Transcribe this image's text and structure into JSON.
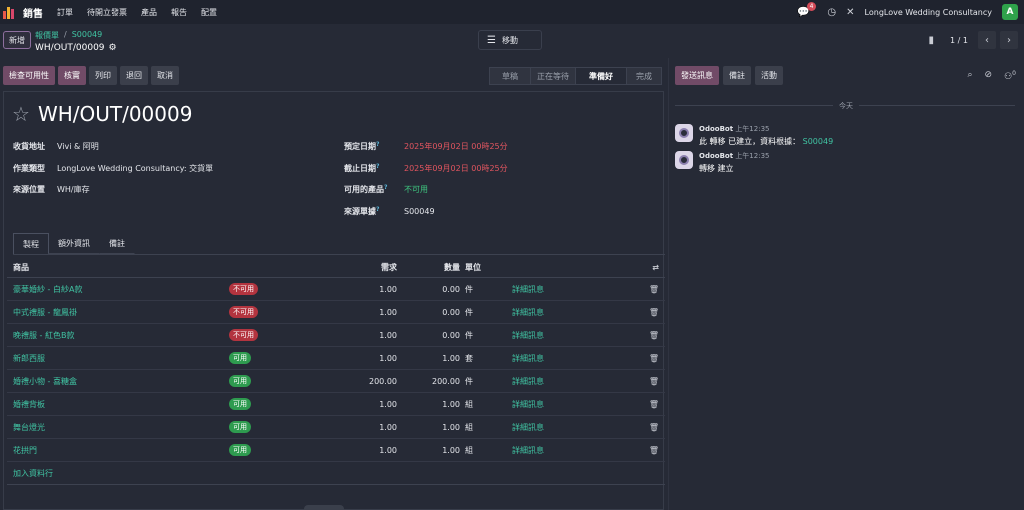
{
  "navbar": {
    "app_name": "銷售",
    "menu": [
      "訂單",
      "待開立發票",
      "產品",
      "報告",
      "配置"
    ],
    "notification_count": "4",
    "company": "LongLove Wedding Consultancy",
    "user_initial": "A"
  },
  "control": {
    "new_label": "新增",
    "breadcrumb": [
      "報價單",
      "S00049"
    ],
    "record_name": "WH/OUT/00009",
    "move_label": "移動",
    "pager": "1 / 1"
  },
  "actions": {
    "check_availability": "檢查可用性",
    "validate": "核實",
    "print": "列印",
    "return": "退回",
    "cancel": "取消"
  },
  "statusbar": {
    "stages": [
      "草稿",
      "正在等待",
      "準備好",
      "完成"
    ],
    "active": "準備好"
  },
  "form": {
    "title": "WH/OUT/00009",
    "left": [
      {
        "label": "收貨地址",
        "value": "Vivi & 阿明"
      },
      {
        "label": "作業類型",
        "value": "LongLove Wedding Consultancy: 交貨單"
      },
      {
        "label": "來源位置",
        "value": "WH/庫存"
      }
    ],
    "right": [
      {
        "label": "預定日期",
        "value": "2025年09月02日 00時25分"
      },
      {
        "label": "截止日期",
        "value": "2025年09月02日 00時25分"
      },
      {
        "label": "可用的產品",
        "value": "不可用"
      },
      {
        "label": "來源單據",
        "value": "S00049"
      }
    ]
  },
  "tabs": [
    "製程",
    "額外資訊",
    "備註"
  ],
  "table": {
    "headers": {
      "product": "商品",
      "demand": "需求",
      "quantity": "數量",
      "unit": "單位"
    },
    "rows": [
      {
        "product": "豪華婚紗 - 白紗A款",
        "status": "不可用",
        "demand": "1.00",
        "quantity": "0.00",
        "unit": "件",
        "detail": "詳細訊息"
      },
      {
        "product": "中式禮服 - 龍鳳褂",
        "status": "不可用",
        "demand": "1.00",
        "quantity": "0.00",
        "unit": "件",
        "detail": "詳細訊息"
      },
      {
        "product": "晚禮服 - 紅色B款",
        "status": "不可用",
        "demand": "1.00",
        "quantity": "0.00",
        "unit": "件",
        "detail": "詳細訊息"
      },
      {
        "product": "新郎西服",
        "status": "可用",
        "demand": "1.00",
        "quantity": "1.00",
        "unit": "套",
        "detail": "詳細訊息"
      },
      {
        "product": "婚禮小物 - 喜糖盒",
        "status": "可用",
        "demand": "200.00",
        "quantity": "200.00",
        "unit": "件",
        "detail": "詳細訊息"
      },
      {
        "product": "婚禮背板",
        "status": "可用",
        "demand": "1.00",
        "quantity": "1.00",
        "unit": "組",
        "detail": "詳細訊息"
      },
      {
        "product": "舞台燈光",
        "status": "可用",
        "demand": "1.00",
        "quantity": "1.00",
        "unit": "組",
        "detail": "詳細訊息"
      },
      {
        "product": "花拱門",
        "status": "可用",
        "demand": "1.00",
        "quantity": "1.00",
        "unit": "組",
        "detail": "詳細訊息"
      }
    ],
    "add_line": "加入資料行"
  },
  "chatter": {
    "send_message": "發送訊息",
    "note": "備註",
    "activity": "活動",
    "followers": "0",
    "date_divider": "今天",
    "messages": [
      {
        "author": "OdooBot",
        "time": "上午12:35",
        "text": "此 轉移 已建立，資料根據：",
        "link": "S00049"
      },
      {
        "author": "OdooBot",
        "time": "上午12:35",
        "text": "轉移 建立",
        "link": ""
      }
    ]
  }
}
